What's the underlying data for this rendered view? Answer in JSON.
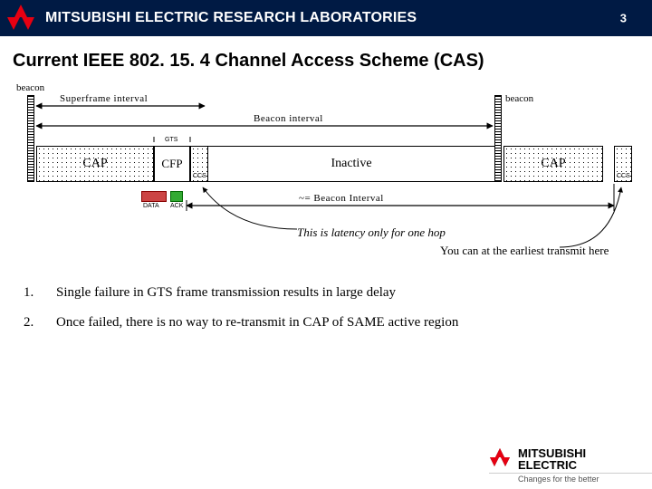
{
  "header": {
    "org": "MITSUBISHI ELECTRIC RESEARCH LABORATORIES",
    "page": "3"
  },
  "title": "Current IEEE 802. 15. 4 Channel Access Scheme (CAS)",
  "diagram": {
    "beacon_left": "beacon",
    "beacon_right": "beacon",
    "superframe_label": "Superframe interval",
    "beacon_interval_label": "Beacon interval",
    "cap": "CAP",
    "cfp": "CFP",
    "gts": "GTS",
    "ccs": "CCS",
    "inactive": "Inactive",
    "cap2": "CAP",
    "ccs2": "CCS",
    "data": "DATA",
    "ack": "ACK",
    "approx_bi": "~= Beacon Interval",
    "latency_note": "This is latency only for one hop",
    "earliest_note": "You can at the earliest transmit here"
  },
  "points": [
    {
      "n": "1.",
      "t": "Single failure in GTS frame transmission results in large delay"
    },
    {
      "n": "2.",
      "t": "Once failed, there is no way to re-transmit in CAP of SAME active region"
    }
  ],
  "footer": {
    "brand1": "MITSUBISHI",
    "brand2": "ELECTRIC",
    "tag": "Changes for the better"
  }
}
